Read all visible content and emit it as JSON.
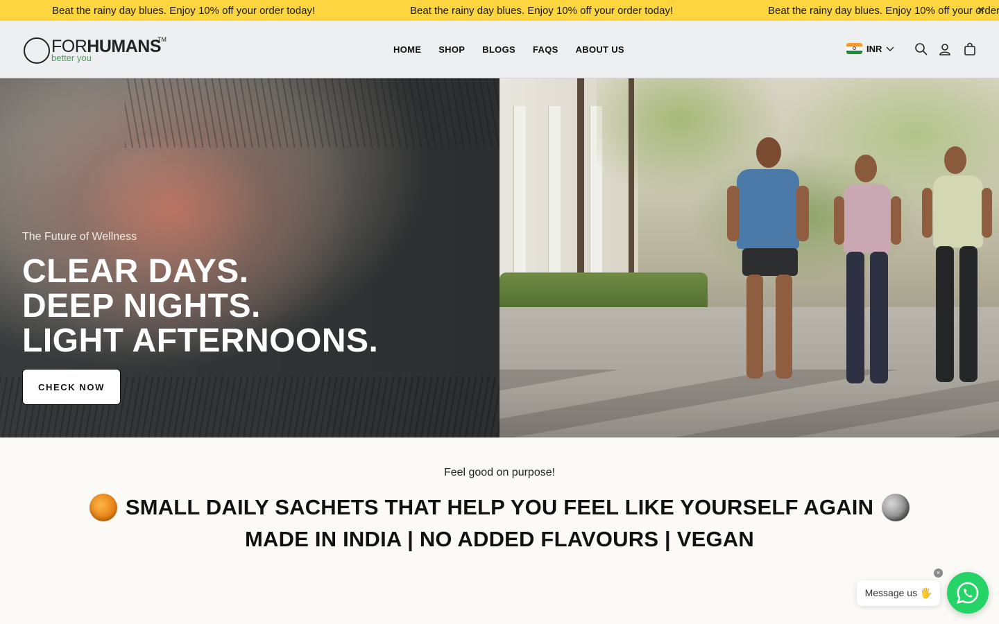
{
  "announcement": {
    "text": "Beat the rainy day blues. Enjoy 10% off your order today!",
    "close_icon": "close-icon"
  },
  "header": {
    "logo": {
      "brand": "FOR HUMANS",
      "brand_light": "FOR",
      "brand_bold": "HUMANS",
      "trademark": "TM",
      "tagline": "better you"
    },
    "nav": [
      {
        "label": "HOME"
      },
      {
        "label": "SHOP"
      },
      {
        "label": "BLOGS"
      },
      {
        "label": "FAQS"
      },
      {
        "label": "ABOUT US"
      }
    ],
    "currency": {
      "code": "INR",
      "flag": "india-flag-icon"
    },
    "icons": [
      "search-icon",
      "account-icon",
      "cart-icon"
    ]
  },
  "hero": {
    "eyebrow": "The Future of Wellness",
    "headline_lines": [
      "CLEAR DAYS.",
      "DEEP NIGHTS.",
      "LIGHT AFTERNOONS."
    ],
    "cta_label": "CHECK NOW"
  },
  "intro": {
    "kicker": "Feel good on purpose!",
    "line1": "SMALL DAILY SACHETS THAT HELP YOU FEEL LIKE YOURSELF AGAIN",
    "line2": "MADE IN INDIA | NO ADDED FLAVOURS | VEGAN",
    "line1_icons": [
      "sun-icon",
      "moon-icon"
    ]
  },
  "chat": {
    "bubble": "Message us 🖐",
    "close": "×",
    "button_icon": "whatsapp-icon"
  },
  "colors": {
    "announcement_bg": "#fdd53f",
    "whatsapp_green": "#25d366",
    "page_bg": "#fbfaf7"
  }
}
